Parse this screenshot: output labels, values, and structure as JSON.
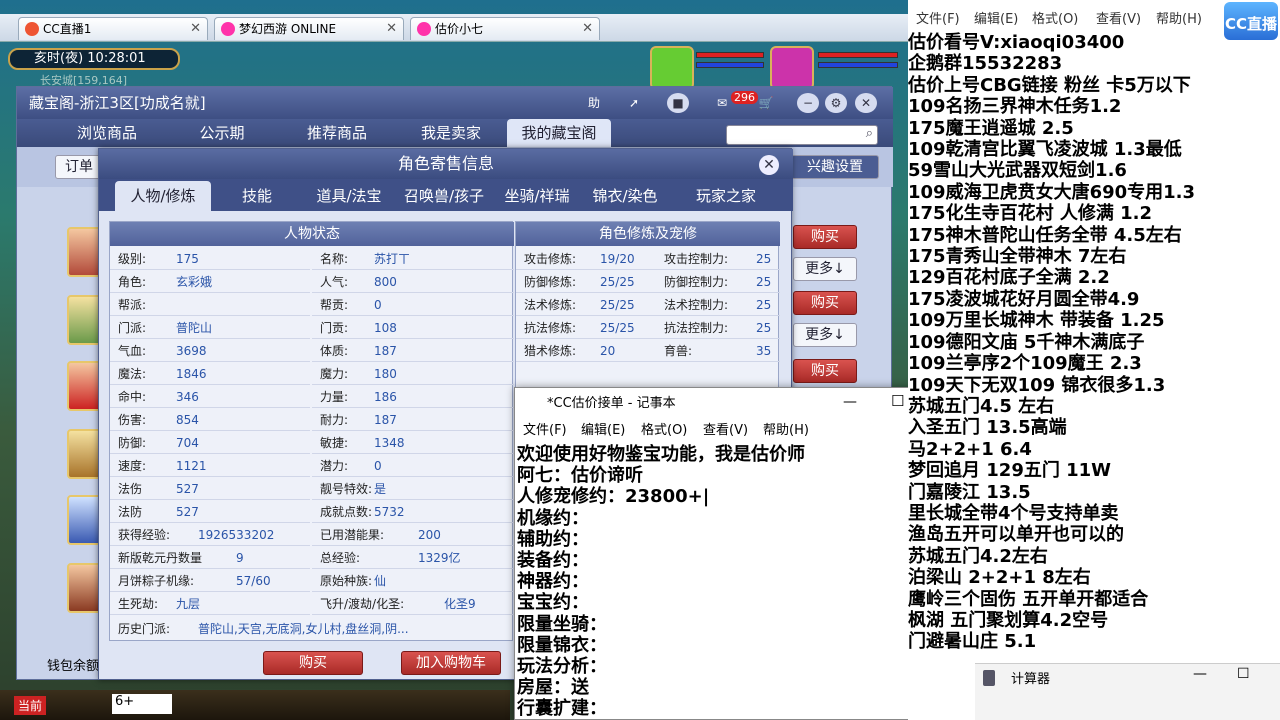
{
  "browser_tabs": [
    {
      "label": "CC直播1"
    },
    {
      "label": "梦幻西游 ONLINE"
    },
    {
      "label": "估价小七"
    }
  ],
  "hud": {
    "time": "亥时(夜)  10:28:01",
    "location": "长安城[159,164]"
  },
  "shop": {
    "title": "藏宝阁-浙江3区[功成名就]",
    "badge": "296",
    "help": "助",
    "nav": [
      "浏览商品",
      "公示期",
      "推荐商品",
      "我是卖家",
      "我的藏宝阁"
    ],
    "order": "订单",
    "interest": "兴趣设置",
    "buy_buttons": [
      "购买",
      "购买",
      "购买"
    ],
    "more_buttons": [
      "更多↓",
      "更多↓"
    ],
    "wallet": "钱包余额"
  },
  "role": {
    "title": "角色寄售信息",
    "tabs": [
      "人物/修炼",
      "技能",
      "道具/法宝",
      "召唤兽/孩子",
      "坐骑/祥瑞",
      "锦衣/染色",
      "玩家之家"
    ],
    "stat_head": "人物状态",
    "cult_head": "角色修炼及宠修",
    "stats_left": [
      {
        "k": "级别:",
        "v": "175"
      },
      {
        "k": "角色:",
        "v": "玄彩娥"
      },
      {
        "k": "帮派:",
        "v": ""
      },
      {
        "k": "门派:",
        "v": "普陀山"
      },
      {
        "k": "气血:",
        "v": "3698"
      },
      {
        "k": "魔法:",
        "v": "1846"
      },
      {
        "k": "命中:",
        "v": "346"
      },
      {
        "k": "伤害:",
        "v": "854"
      },
      {
        "k": "防御:",
        "v": "704"
      },
      {
        "k": "速度:",
        "v": "1121"
      },
      {
        "k": "法伤",
        "v": "527"
      },
      {
        "k": "法防",
        "v": "527"
      },
      {
        "k": "获得经验:",
        "v": "1926533202"
      },
      {
        "k": "新版乾元丹数量",
        "v": "9"
      },
      {
        "k": "月饼粽子机缘:",
        "v": "57/60"
      },
      {
        "k": "生死劫:",
        "v": "九层"
      }
    ],
    "stats_right": [
      {
        "k": "名称:",
        "v": "苏打ㄒ"
      },
      {
        "k": "人气:",
        "v": "800"
      },
      {
        "k": "帮贡:",
        "v": "0"
      },
      {
        "k": "门贡:",
        "v": "108"
      },
      {
        "k": "体质:",
        "v": "187"
      },
      {
        "k": "魔力:",
        "v": "180"
      },
      {
        "k": "力量:",
        "v": "186"
      },
      {
        "k": "耐力:",
        "v": "187"
      },
      {
        "k": "敏捷:",
        "v": "1348"
      },
      {
        "k": "潜力:",
        "v": "0"
      },
      {
        "k": "靓号特效:",
        "v": "是"
      },
      {
        "k": "成就点数:",
        "v": "5732"
      },
      {
        "k": "已用潜能果:",
        "v": "200"
      },
      {
        "k": "总经验:",
        "v": "1329亿"
      },
      {
        "k": "原始种族:",
        "v": "仙"
      },
      {
        "k": "飞升/渡劫/化圣:",
        "v": "化圣9"
      }
    ],
    "history": {
      "k": "历史门派:",
      "v": "普陀山,天宫,无底洞,女儿村,盘丝洞,阴..."
    },
    "cultivation": [
      {
        "k": "攻击修炼:",
        "v": "19/20",
        "k2": "攻击控制力:",
        "v2": "25"
      },
      {
        "k": "防御修炼:",
        "v": "25/25",
        "k2": "防御控制力:",
        "v2": "25"
      },
      {
        "k": "法术修炼:",
        "v": "25/25",
        "k2": "法术控制力:",
        "v2": "25"
      },
      {
        "k": "抗法修炼:",
        "v": "25/25",
        "k2": "抗法控制力:",
        "v2": "25"
      },
      {
        "k": "猎术修炼:",
        "v": "20",
        "k2": "育兽:",
        "v2": "35"
      }
    ],
    "buy": "购买",
    "cart": "加入购物车"
  },
  "notepad": {
    "title": "*CC估价接单 - 记事本",
    "menu": [
      "文件(F)",
      "编辑(E)",
      "格式(O)",
      "查看(V)",
      "帮助(H)"
    ],
    "lines": [
      "欢迎使用好物鉴宝功能，我是估价师",
      "阿七：估价谛听",
      "人修宠修约：23800+|",
      "机缘约：",
      "辅助约：",
      "装备约：",
      "神器约：",
      "宝宝约：",
      "限量坐骑：",
      "限量锦衣：",
      "玩法分析：",
      "房屋：送",
      "行囊扩建："
    ]
  },
  "right_panel": {
    "menu": [
      "文件(F)",
      "编辑(E)",
      "格式(O)",
      "查看(V)",
      "帮助(H)"
    ],
    "lines": [
      "估价看号V:xiaoqi03400",
      "企鹅群15532283",
      "估价上号CBG链接 粉丝 卡5万以下",
      "109名扬三界神木任务1.2",
      "175魔王逍遥城 2.5",
      "109乾清宫比翼飞凌波城 1.3最低",
      "59雪山大光武器双短剑1.6",
      "109威海卫虎贲女大唐690专用1.3",
      "175化生寺百花村 人修满 1.2",
      "175神木普陀山任务全带 4.5左右",
      "175青秀山全带神木  7左右",
      "129百花村底子全满 2.2",
      "175凌波城花好月圆全带4.9",
      "109万里长城神木 带装备  1.25",
      "109德阳文庙 5千神木满底子",
      "109兰亭序2个109魔王 2.3",
      "109天下无双109  锦衣很多1.3",
      "苏城五门4.5 左右",
      "入圣五门  13.5高端",
      "马2+2+1  6.4",
      "梦回追月 129五门 11W",
      "门嘉陵江 13.5",
      "里长城全带4个号支持单卖",
      "渔岛五开可以单开也可以的",
      "苏城五门4.2左右",
      "泊梁山 2+2+1 8左右",
      "鹰岭三个固伤 五开单开都适合",
      "枫湖 五门聚划算4.2空号",
      "门避暑山庄  5.1"
    ],
    "calc": "计算器",
    "logo": "CC直播"
  },
  "bottom": {
    "current": "当前",
    "input": "6+"
  }
}
